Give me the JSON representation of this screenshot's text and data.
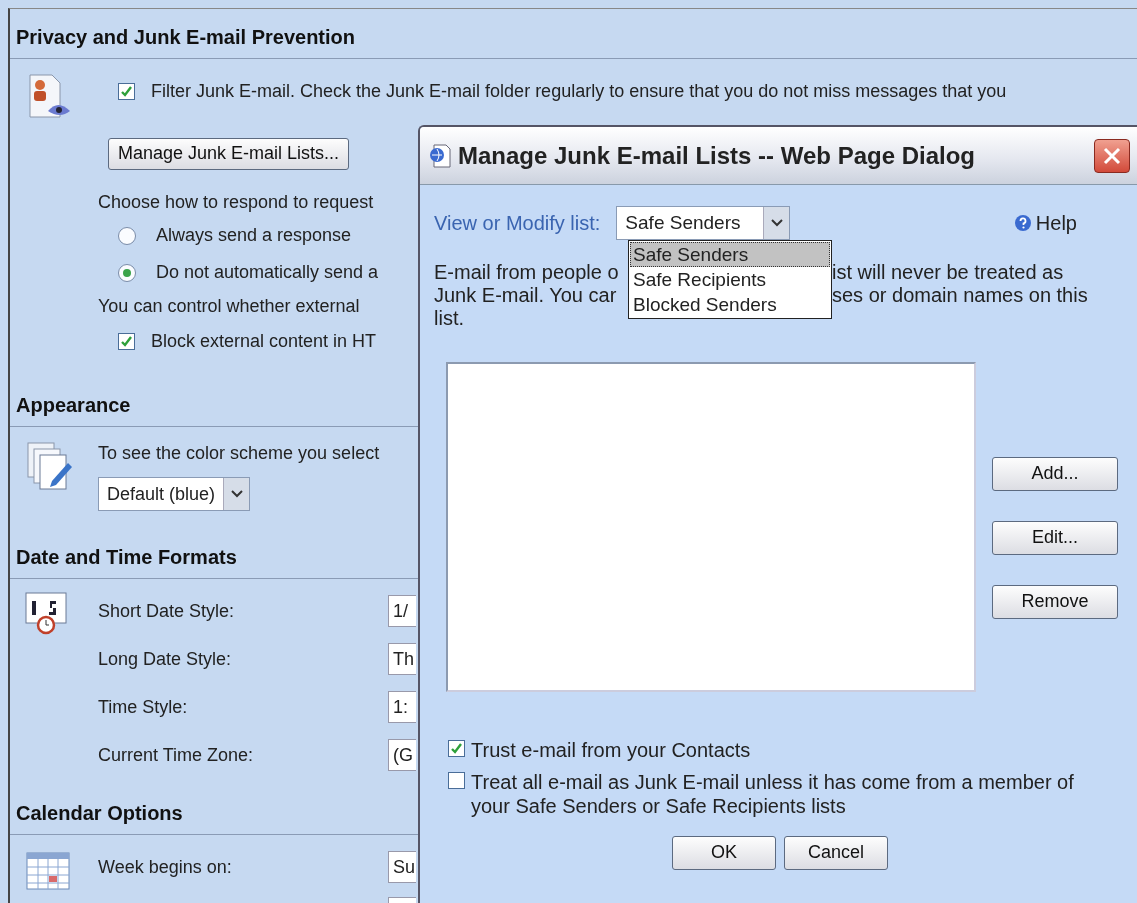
{
  "sections": [
    {
      "title": "Privacy and Junk E-mail Prevention",
      "items": [
        {
          "kind": "checkbox",
          "label": "Filter Junk E-mail. Check the Junk E-mail folder regularly to ensure that you do not miss messages that you",
          "checked": true
        },
        {
          "kind": "button",
          "label": "Manage Junk E-mail Lists..."
        },
        {
          "kind": "text",
          "text": "Choose how to respond to request"
        },
        {
          "kind": "radio",
          "label": "Always send a response",
          "selected": false
        },
        {
          "kind": "radio",
          "label": "Do not automatically send a",
          "selected": true
        },
        {
          "kind": "text",
          "text": "You can control whether external"
        },
        {
          "kind": "checkbox",
          "label": "Block external content in HT",
          "checked": true
        }
      ]
    },
    {
      "title": "Appearance",
      "items": [
        {
          "kind": "text",
          "text": "To see the color scheme you select"
        },
        {
          "kind": "select",
          "value": "Default (blue)"
        }
      ]
    },
    {
      "title": "Date and Time Formats",
      "items": [
        {
          "kind": "field",
          "label": "Short Date Style:",
          "value": "1/"
        },
        {
          "kind": "field",
          "label": "Long Date Style:",
          "value": "Th"
        },
        {
          "kind": "field",
          "label": "Time Style:",
          "value": "1:"
        },
        {
          "kind": "field",
          "label": "Current Time Zone:",
          "value": "(G"
        }
      ]
    },
    {
      "title": "Calendar Options",
      "items": [
        {
          "kind": "field",
          "label": "Week begins on:",
          "value": "Su"
        },
        {
          "kind": "field"
        }
      ]
    }
  ],
  "dialog": {
    "title": "Manage Junk E-mail Lists -- Web Page Dialog",
    "list_label": "View or Modify list:",
    "list_select": {
      "value": "Safe Senders",
      "expanded": true,
      "options": [
        {
          "label": "Safe Senders",
          "selected": true
        },
        {
          "label": "Safe Recipients",
          "selected": false
        },
        {
          "label": "Blocked Senders",
          "selected": false
        }
      ]
    },
    "help": "Help",
    "description_lines": [
      {
        "left": "E-mail from people o",
        "right": "ist will never be treated as"
      },
      {
        "left": "Junk E-mail. You car",
        "right": "ses or domain names on this"
      },
      {
        "left": "list."
      }
    ],
    "side_buttons": [
      "Add...",
      "Edit...",
      "Remove"
    ],
    "options": [
      {
        "label": "Trust e-mail from your Contacts",
        "checked": true
      },
      {
        "label": "Treat all e-mail as Junk E-mail unless it has come from a member of your Safe Senders or Safe Recipients lists",
        "checked": false
      }
    ],
    "buttons": [
      "OK",
      "Cancel"
    ]
  }
}
